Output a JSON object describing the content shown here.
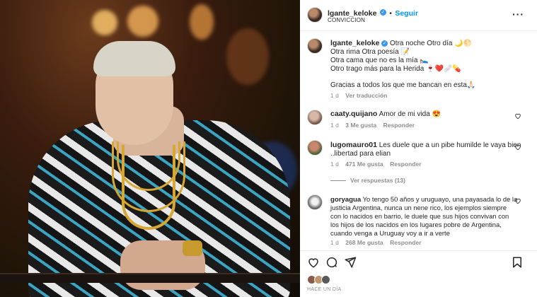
{
  "post": {
    "author": "lgante_keloke",
    "follow_label": "Seguir",
    "separator": "•",
    "subtitle": "CONVICCION",
    "more_label": "···"
  },
  "caption": {
    "author": "lgante_keloke",
    "line1": "Otra noche Otro día 🌙🌕",
    "line2": "Otra rima Otra poesía 📝",
    "line3": "Otra cama que no es la mía 🛌",
    "line4": "Otro trago más para la Herida 🍷❤️🩹💊",
    "line5": "Gracias a todos los que me bancan en esta🙏🏻",
    "time": "1 d",
    "translate": "Ver traducción"
  },
  "comments": [
    {
      "user": "caaty.quijano",
      "text": "Amor de mi vida 😍",
      "time": "1 d",
      "likes": "3 Me gusta",
      "reply": "Responder"
    },
    {
      "user": "lugomauro01",
      "text": "Les duele que a un pibe humilde le vaya bien ..libertad para elian",
      "line1": "Les duele que a un pibe humilde le vaya bien",
      "line2": "..libertad para elian",
      "time": "1 d",
      "likes": "471 Me gusta",
      "reply": "Responder",
      "view_replies": "Ver respuestas (13)"
    },
    {
      "user": "goryagua",
      "line1": "Yo tengo 50 años y uruguayo, una payasada lo de la",
      "line2": "justicia Argentina, nunca un nene rico, los ejemplos siempre",
      "line3": "con lo nacidos en barrio, le duele que sus hijos convivan con",
      "line4": "los hijos de los nacidos en los lugares pobre de Argentina,",
      "line5": "cuando venga a Uruguay voy a ir a verte",
      "time": "1 d",
      "likes": "268 Me gusta",
      "reply": "Responder"
    }
  ],
  "footer": {
    "timestamp": "HACE UN DÍA"
  },
  "colors": {
    "link_blue": "#0095f6",
    "verified_blue": "#3897f0",
    "text": "#262626",
    "muted": "#8e8e8e"
  },
  "icons": [
    "heart-icon",
    "comment-icon",
    "share-icon",
    "save-icon",
    "more-icon",
    "verified-icon"
  ]
}
